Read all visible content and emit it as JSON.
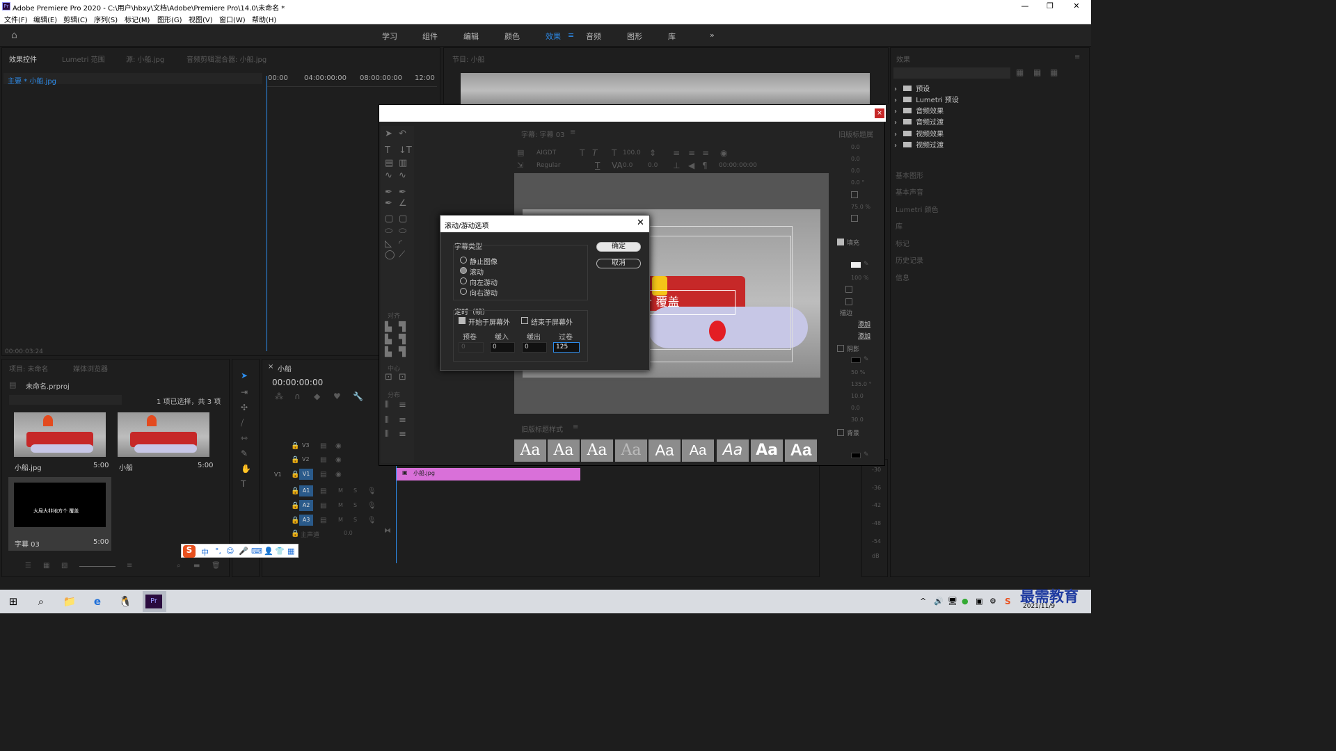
{
  "app": {
    "title": "Adobe Premiere Pro 2020 - C:\\用户\\hbxy\\文档\\Adobe\\Premiere Pro\\14.0\\未命名 *",
    "logo": "Pr"
  },
  "menu": [
    "文件(F)",
    "编辑(E)",
    "剪辑(C)",
    "序列(S)",
    "标记(M)",
    "图形(G)",
    "视图(V)",
    "窗口(W)",
    "帮助(H)"
  ],
  "workspaces": [
    "学习",
    "组件",
    "编辑",
    "颜色",
    "效果",
    "音频",
    "图形",
    "库"
  ],
  "effect_controls": {
    "tabs": [
      "效果控件",
      "Lumetri 范围",
      "源: 小船.jpg",
      "音频剪辑混合器: 小船.jpg"
    ],
    "clip": "主要 * 小船.jpg",
    "ruler": [
      "00:00",
      "04:00:00:00",
      "08:00:00:00",
      "12:00"
    ],
    "timecode": "00:00:03:24"
  },
  "program": {
    "tab": "节目: 小船"
  },
  "project": {
    "tabs": [
      "项目: 未命名",
      "媒体浏览器"
    ],
    "file": "未命名.prproj",
    "count": "1 项已选择，共 3 项",
    "items": [
      {
        "name": "小船.jpg",
        "dur": "5:00"
      },
      {
        "name": "小船",
        "dur": "5:00"
      },
      {
        "name": "字幕 03",
        "dur": "5:00"
      }
    ],
    "caption_thumb": "大局大非地方个  覆盖"
  },
  "timeline": {
    "tab": "小船",
    "timecode": "00:00:00:00",
    "tracks": [
      "V3",
      "V2",
      "V1",
      "A1",
      "A2",
      "A3"
    ],
    "v1src": "V1",
    "master": "主声道",
    "master_val": "0.0",
    "clip": "小船.jpg",
    "audio_flags": [
      "M",
      "S"
    ]
  },
  "titler": {
    "tab": "字幕: 字幕 03",
    "font": "AIGDT",
    "style": "Regular",
    "size": "100.0",
    "kern": "0.0",
    "lead": "0.0",
    "timecode": "00:00:00:00",
    "align": "对齐",
    "center": "中心",
    "distribute": "分布",
    "caption_text": "地方个  覆盖",
    "styles_tab": "旧版标题样式",
    "aa": "Aa",
    "props_tab": "旧版标题属",
    "props": [
      "0.0",
      "0.0",
      "0.0",
      "0.0 °",
      "75.0 %",
      "填充",
      "100 %",
      "描边",
      "添加",
      "添加",
      "阴影",
      "50 %",
      "135.0 °",
      "10.0",
      "0.0",
      "30.0",
      "背景"
    ]
  },
  "modal": {
    "title": "滚动/游动选项",
    "type_label": "字幕类型",
    "types": [
      "静止图像",
      "滚动",
      "向左游动",
      "向右游动"
    ],
    "selected": 1,
    "timing_label": "定时（帧）",
    "start_off": "开始于屏幕外",
    "end_off": "结束于屏幕外",
    "cols": [
      "预卷",
      "缓入",
      "缓出",
      "过卷"
    ],
    "vals": [
      "0",
      "0",
      "0",
      "125"
    ],
    "ok": "确定",
    "cancel": "取消"
  },
  "effects": {
    "title": "效果",
    "items": [
      "预设",
      "Lumetri 预设",
      "音频效果",
      "音频过渡",
      "视频效果",
      "视频过渡"
    ],
    "sections": [
      "基本图形",
      "基本声音",
      "Lumetri 颜色",
      "库",
      "标记",
      "历史记录",
      "信息"
    ]
  },
  "meter": {
    "scale": [
      "-30",
      "-36",
      "-42",
      "-48",
      "-54",
      "dB"
    ]
  },
  "taskbar": {
    "date": "2021/11/9",
    "brand": "最需教育"
  },
  "ime": {
    "text": "中"
  }
}
